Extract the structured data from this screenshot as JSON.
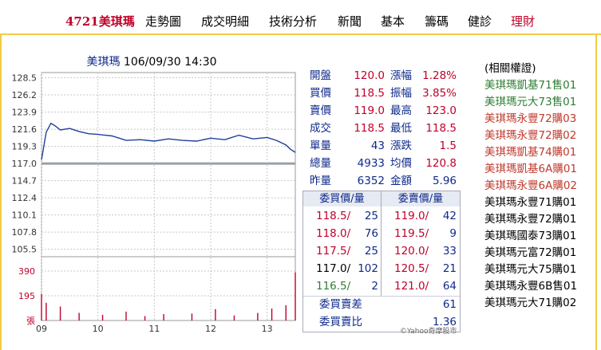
{
  "nav": {
    "stock_label": "4721美琪瑪",
    "items": [
      "走勢圖",
      "成交明細",
      "技術分析",
      "新聞",
      "基本",
      "籌碼",
      "健診",
      "理財"
    ]
  },
  "chart": {
    "name": "美琪瑪",
    "datetime": "106/09/30 14:30"
  },
  "quote": {
    "open_label": "開盤",
    "open": "120.0",
    "change_pct_label": "漲幅",
    "change_pct": "1.28%",
    "bid_label": "買價",
    "bid": "118.5",
    "amplitude_label": "振幅",
    "amplitude": "3.85%",
    "ask_label": "賣價",
    "ask": "119.0",
    "high_label": "最高",
    "high": "123.0",
    "last_label": "成交",
    "last": "118.5",
    "low_label": "最低",
    "low": "118.5",
    "volume_label": "單量",
    "volume": "43",
    "change_label": "漲跌",
    "change": "1.5",
    "total_label": "總量",
    "total": "4933",
    "avg_label": "均價",
    "avg": "120.8",
    "prev_label": "昨量",
    "prev": "6352",
    "amount_label": "金額",
    "amount": "5.96"
  },
  "orders": {
    "bid_header": "委買價/量",
    "ask_header": "委賣價/量",
    "rows": [
      {
        "bid_price": "118.5/",
        "bid_qty": "25",
        "ask_price": "119.0/",
        "ask_qty": "42"
      },
      {
        "bid_price": "118.0/",
        "bid_qty": "76",
        "ask_price": "119.5/",
        "ask_qty": "9"
      },
      {
        "bid_price": "117.5/",
        "bid_qty": "25",
        "ask_price": "120.0/",
        "ask_qty": "33"
      },
      {
        "bid_price": "117.0/",
        "bid_qty": "102",
        "ask_price": "120.5/",
        "ask_qty": "21"
      },
      {
        "bid_price": "116.5/",
        "bid_qty": "2",
        "ask_price": "121.0/",
        "ask_qty": "64"
      }
    ],
    "diff_label": "委買賣差",
    "diff": "61",
    "ratio_label": "委買賣比",
    "ratio": "1.36"
  },
  "warrants": {
    "title": "(相關權證)",
    "items": [
      {
        "name": "美琪瑪凱基71售01",
        "color": "#2e7d32"
      },
      {
        "name": "美琪瑪元大73售01",
        "color": "#2e7d32"
      },
      {
        "name": "美琪瑪永豐72購03",
        "color": "#c0392b"
      },
      {
        "name": "美琪瑪永豐72購02",
        "color": "#c0392b"
      },
      {
        "name": "美琪瑪凱基74購01",
        "color": "#c0392b"
      },
      {
        "name": "美琪瑪凱基6A購01",
        "color": "#c0392b"
      },
      {
        "name": "美琪瑪永豐6A購02",
        "color": "#c0392b"
      },
      {
        "name": "美琪瑪永豐71購01",
        "color": "#000000"
      },
      {
        "name": "美琪瑪永豐72購01",
        "color": "#000000"
      },
      {
        "name": "美琪瑪國泰73購01",
        "color": "#000000"
      },
      {
        "name": "美琪瑪元富72購01",
        "color": "#000000"
      },
      {
        "name": "美琪瑪元大75購01",
        "color": "#000000"
      },
      {
        "name": "美琪瑪永豐6B售01",
        "color": "#000000"
      },
      {
        "name": "美琪瑪元大71購02",
        "color": "#000000"
      }
    ]
  },
  "copyright": "©Yahoo奇摩股市",
  "chart_data": {
    "type": "line",
    "price_ticks": [
      "128.5",
      "126.2",
      "123.9",
      "121.6",
      "119.3",
      "117.0",
      "114.7",
      "112.4",
      "110.1",
      "107.8",
      "105.5"
    ],
    "volume_ticks": [
      "390",
      "195",
      "張"
    ],
    "time_ticks": [
      "09",
      "10",
      "11",
      "12",
      "13"
    ],
    "prev_close": 117.0,
    "ylim": [
      104.5,
      129.2
    ],
    "x": [
      "09:00",
      "09:05",
      "09:10",
      "09:15",
      "09:20",
      "09:30",
      "09:40",
      "09:50",
      "10:00",
      "10:15",
      "10:30",
      "10:45",
      "11:00",
      "11:15",
      "11:30",
      "11:45",
      "12:00",
      "12:15",
      "12:30",
      "12:45",
      "13:00",
      "13:10",
      "13:20",
      "13:25",
      "13:30"
    ],
    "values": [
      117.5,
      121.2,
      122.4,
      122.0,
      121.5,
      121.7,
      121.3,
      121.0,
      120.9,
      120.7,
      120.1,
      120.2,
      120.0,
      120.3,
      120.1,
      120.0,
      120.4,
      120.2,
      120.8,
      120.3,
      120.5,
      120.1,
      119.5,
      118.9,
      118.5
    ],
    "volume_ylim": [
      0,
      390
    ],
    "volume_x": [
      "09:00",
      "09:05",
      "09:20",
      "09:40",
      "10:05",
      "10:30",
      "10:50",
      "11:10",
      "11:40",
      "12:05",
      "12:25",
      "12:50",
      "13:05",
      "13:20",
      "13:30"
    ],
    "volume_values": [
      210,
      140,
      110,
      60,
      45,
      70,
      35,
      50,
      55,
      90,
      40,
      60,
      95,
      120,
      380
    ]
  }
}
